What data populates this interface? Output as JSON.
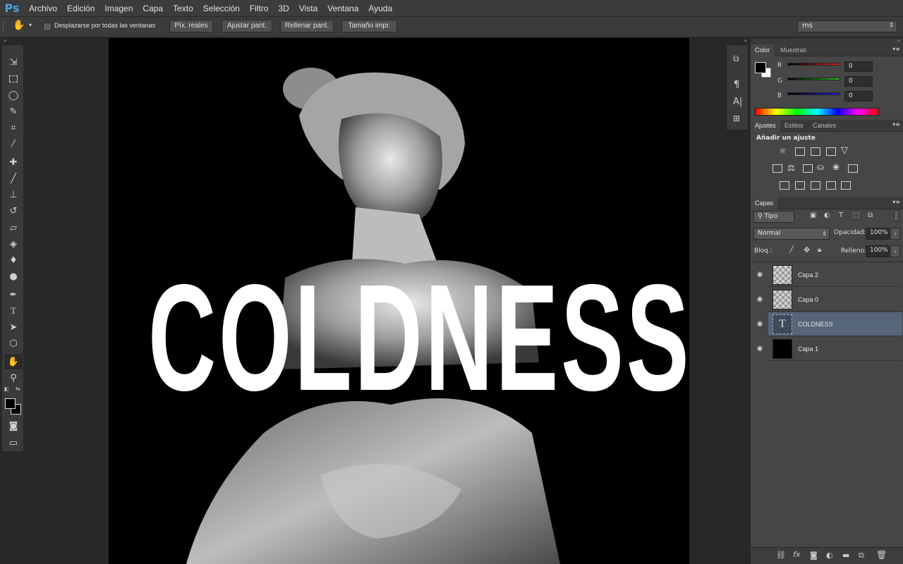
{
  "app": {
    "logo": "Ps"
  },
  "menu": [
    "Archivo",
    "Edición",
    "Imagen",
    "Capa",
    "Texto",
    "Selección",
    "Filtro",
    "3D",
    "Vista",
    "Ventana",
    "Ayuda"
  ],
  "options": {
    "scroll_all_label": "Desplazarse por todas las ventanas",
    "buttons": [
      "Píx. reales",
      "Ajustar pant.",
      "Rellenar pant.",
      "Tamaño impr."
    ],
    "workspace_value": "ms"
  },
  "canvas": {
    "text_layer_content": "COLDNESS"
  },
  "color_panel": {
    "tabs": [
      "Color",
      "Muestras"
    ],
    "r_label": "R",
    "g_label": "G",
    "b_label": "B",
    "r_value": "0",
    "g_value": "0",
    "b_value": "0",
    "colors": {
      "foreground": "#000000",
      "background": "#ffffff",
      "r": "#e02020",
      "g": "#20c020",
      "b": "#2020e0"
    }
  },
  "adjust_panel": {
    "tabs": [
      "Ajustes",
      "Estilos",
      "Canales"
    ],
    "heading": "Añadir un ajuste"
  },
  "layers_panel": {
    "tab": "Capas",
    "filter_kind": "Tipo",
    "blend_mode": "Normal",
    "opacity_label": "Opacidad:",
    "opacity_value": "100%",
    "lock_label": "Bloq.:",
    "fill_label": "Relleno:",
    "fill_value": "100%",
    "layers": [
      {
        "name": "Capa 2",
        "selected": false
      },
      {
        "name": "Capa 0",
        "selected": false
      },
      {
        "name": "COLDNESS",
        "selected": true
      },
      {
        "name": "Capa 1",
        "selected": false
      }
    ]
  },
  "icons": {
    "toolbar": [
      "move-icon",
      "marquee-icon",
      "lasso-icon",
      "quick-select-icon",
      "crop-icon",
      "eyedropper-icon",
      "healing-brush-icon",
      "brush-icon",
      "clone-stamp-icon",
      "history-brush-icon",
      "eraser-icon",
      "paint-bucket-icon",
      "blur-icon",
      "dodge-icon",
      "pen-icon",
      "type-icon",
      "path-select-icon",
      "shape-icon",
      "hand-icon",
      "zoom-icon"
    ]
  }
}
